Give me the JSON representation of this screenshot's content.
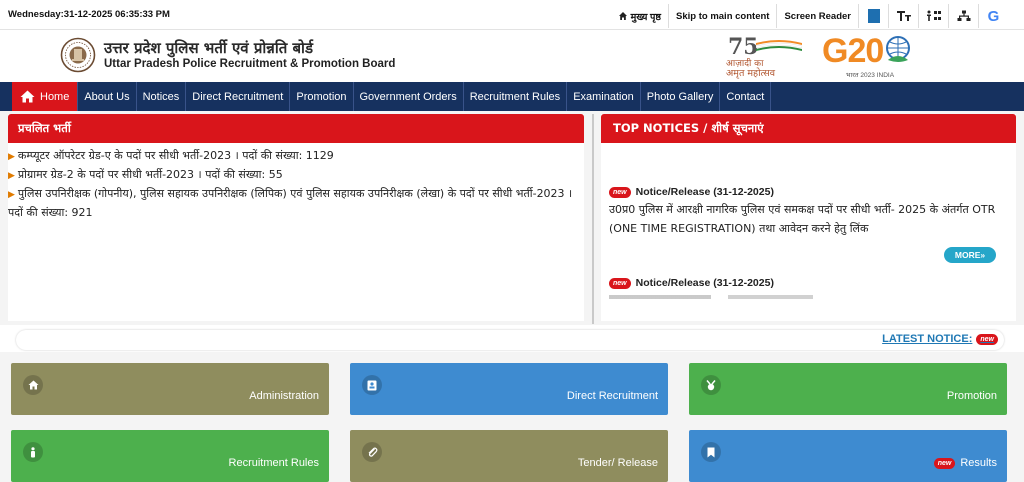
{
  "topbar": {
    "datetime": "Wednesday:31-12-2025 06:35:33 PM",
    "home_link": "मुख्य पृष्ठ",
    "skip_link": "Skip to main content",
    "screen_reader": "Screen Reader",
    "text_size_icon": "text-size-icon",
    "accessibility_icon": "accessibility-icon",
    "sitemap_icon": "sitemap-icon",
    "google_letter": "G"
  },
  "header": {
    "title_hindi": "उत्तर प्रदेश पुलिस भर्ती एवं प्रोन्नति बोर्ड",
    "title_english": "Uttar Pradesh Police Recruitment & Promotion Board",
    "azadi_number": "75",
    "azadi_text1": "आज़ादी का",
    "azadi_text2": "अमृत महोत्सव",
    "g20_text": "G20",
    "g20_sub": "भारत 2023 INDIA"
  },
  "nav": {
    "items": [
      "Home",
      "About Us",
      "Notices",
      "Direct Recruitment",
      "Promotion",
      "Government Orders",
      "Recruitment Rules",
      "Examination",
      "Photo Gallery",
      "Contact"
    ]
  },
  "bhrti": {
    "heading": "प्रचलित भर्ती",
    "items": [
      "कम्प्यूटर ऑपरेटर ग्रेड-ए के पदों पर सीधी भर्ती-2023 । पदों की संख्या: 1129",
      "प्रोग्रामर ग्रेड-2 के पदों पर सीधी भर्ती-2023 । पदों की संख्या: 55",
      "पुलिस उपनिरीक्षक (गोपनीय), पुलिस सहायक उपनिरीक्षक (लिपिक) एवं पुलिस सहायक उपनिरीक्षक (लेखा) के पदों पर सीधी भर्ती-2023 । पदों की संख्या: 921"
    ]
  },
  "top_notices": {
    "heading": "TOP NOTICES / शीर्ष सूचनाएं",
    "new_badge": "new",
    "notice1_title": "Notice/Release (31-12-2025)",
    "notice1_body": "उ0प्र0 पुलिस में आरक्षी नागरिक पुलिस एवं समकक्ष पदों पर सीधी भर्ती- 2025 के अंतर्गत OTR (ONE TIME REGISTRATION) तथा आवेदन करने हेतु लिंक",
    "more_label": "MORE»",
    "notice2_title": "Notice/Release (31-12-2025)"
  },
  "latest": {
    "label": "LATEST NOTICE:",
    "badge": "new"
  },
  "tiles": [
    {
      "label": "Administration",
      "icon": "home-icon",
      "color": "#8f8d5e"
    },
    {
      "label": "Direct Recruitment",
      "icon": "id-card-icon",
      "color": "#3e8bd0"
    },
    {
      "label": "Promotion",
      "icon": "medal-icon",
      "color": "#4db04d"
    },
    {
      "label": "Recruitment Rules",
      "icon": "person-icon",
      "color": "#4db04d"
    },
    {
      "label": "Tender/ Release",
      "icon": "paperclip-icon",
      "color": "#8f8d5e"
    },
    {
      "label": "Results",
      "icon": "bookmark-icon",
      "color": "#3e8bd0",
      "badge": "new"
    }
  ]
}
